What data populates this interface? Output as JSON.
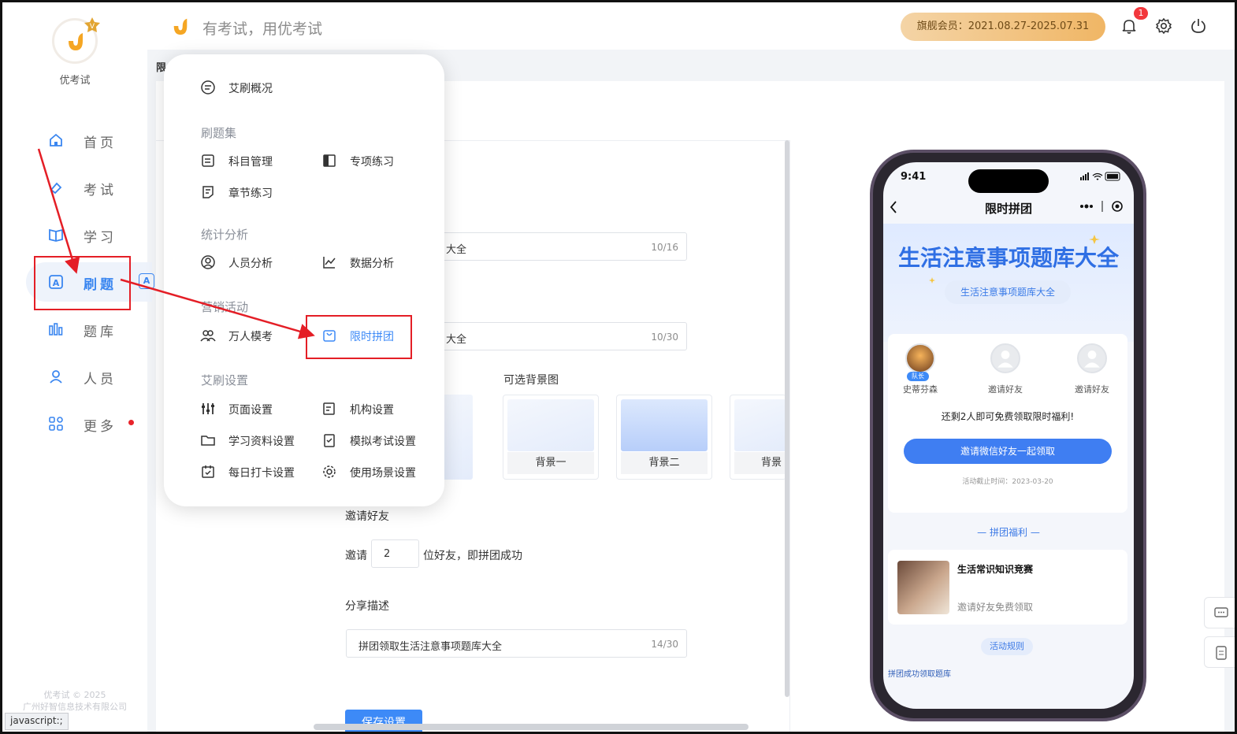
{
  "app": {
    "name": "优考试",
    "slogan": "有考试，用优考试",
    "footer_line1": "优考试 © 2025",
    "footer_line2": "广州好智信息技术有限公司",
    "status_tip": "javascript:;"
  },
  "header": {
    "vip_text": "旗舰会员：2021.08.27-2025.07.31",
    "notification_count": "1",
    "breadcrumb_fragment": "限"
  },
  "sidebar": {
    "items": [
      {
        "label": "首页",
        "icon": "home-icon"
      },
      {
        "label": "考试",
        "icon": "eraser-icon"
      },
      {
        "label": "学习",
        "icon": "book-icon"
      },
      {
        "label": "刷题",
        "icon": "brush-a-icon"
      },
      {
        "label": "题库",
        "icon": "bars-icon"
      },
      {
        "label": "人员",
        "icon": "person-icon"
      },
      {
        "label": "更多",
        "icon": "grid-more-icon"
      }
    ],
    "more_dot_color": "#e8232a"
  },
  "popup": {
    "overview": "艾刷概况",
    "sections": [
      {
        "title": "刷题集",
        "items": [
          "科目管理",
          "专项练习",
          "章节练习"
        ]
      },
      {
        "title": "统计分析",
        "items": [
          "人员分析",
          "数据分析"
        ]
      },
      {
        "title": "营销活动",
        "items": [
          "万人模考",
          "限时拼团"
        ]
      },
      {
        "title": "艾刷设置",
        "items": [
          "页面设置",
          "机构设置",
          "学习资料设置",
          "模拟考试设置",
          "每日打卡设置",
          "使用场景设置"
        ]
      }
    ],
    "active_item": "限时拼团"
  },
  "form": {
    "title_field": {
      "value": "大全",
      "count": "10/16"
    },
    "sub_field": {
      "value": "大全",
      "count": "10/30"
    },
    "bg_label": "可选背景图",
    "bg_options": [
      "背景一",
      "背景二",
      "背景"
    ],
    "invite_label": "邀请好友",
    "invite_prefix": "邀请",
    "invite_value": "2",
    "invite_suffix": "位好友，即拼团成功",
    "share_label": "分享描述",
    "share_field": {
      "value": "拼团领取生活注意事项题库大全",
      "count": "14/30"
    },
    "save_label": "保存设置"
  },
  "phone": {
    "time": "9:41",
    "nav_title": "限时拼团",
    "title": "生活注意事项题库大全",
    "subtitle": "生活注意事项题库大全",
    "members": [
      {
        "name": "史蒂芬森",
        "tag": "队长"
      },
      {
        "name": "邀请好友"
      },
      {
        "name": "邀请好友"
      }
    ],
    "remain_text": "还剩2人即可免费领取限时福利!",
    "invite_btn": "邀请微信好友一起领取",
    "deadline": "活动截止时间：2023-03-20",
    "benefit_header": "拼团福利",
    "benefit_title": "生活常识知识竞赛",
    "benefit_sub": "邀请好友免费领取",
    "rules_btn": "活动规则",
    "bottom_tip": "拼团成功领取题库"
  },
  "colors": {
    "accent": "#3d8af7",
    "highlight_box": "#e41e26",
    "vip_gold": "#f0b665"
  }
}
